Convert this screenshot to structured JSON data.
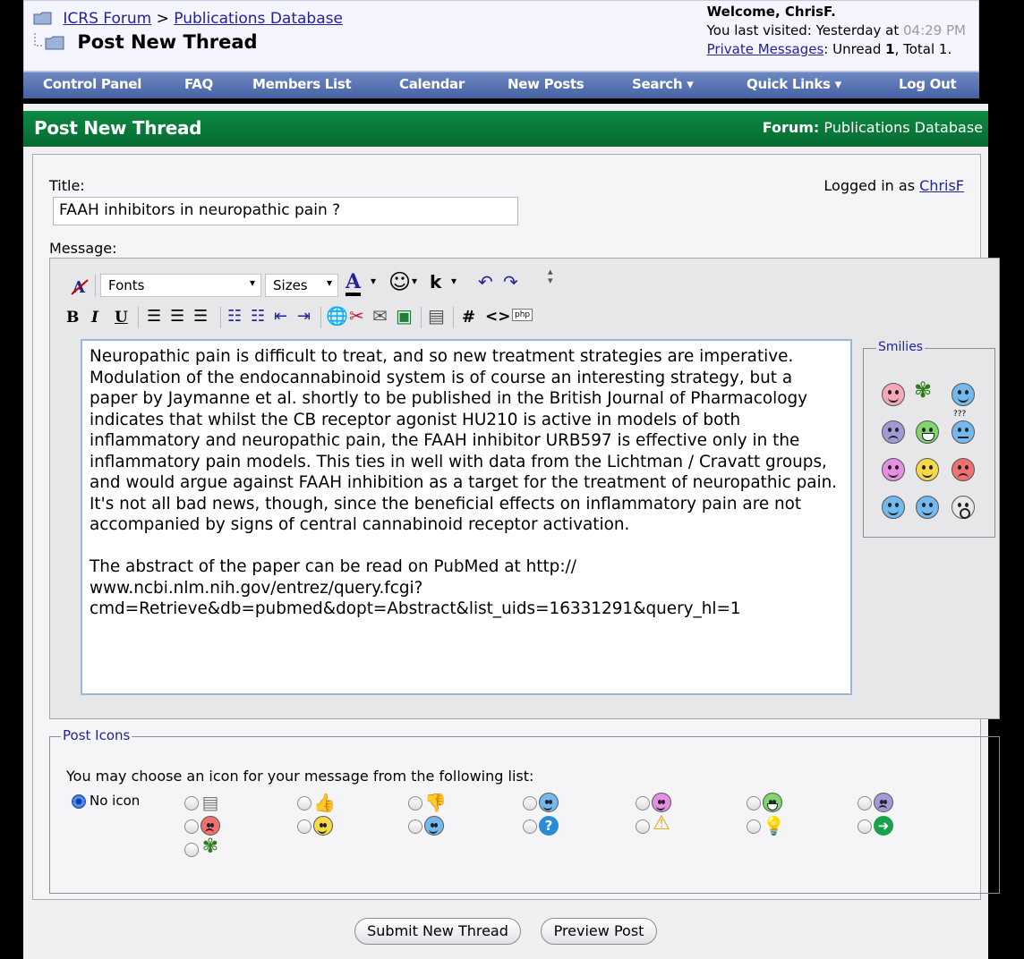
{
  "header": {
    "breadcrumb_forum": "ICRS Forum",
    "breadcrumb_sep": ">",
    "breadcrumb_current": "Publications Database",
    "page_title": "Post New Thread",
    "welcome": "Welcome, ChrisF.",
    "last_visited_label": "You last visited: Yesterday at",
    "last_visited_time": "04:29 PM",
    "pm_link": "Private Messages",
    "pm_unread_label": ": Unread",
    "pm_unread": "1",
    "pm_total": ", Total 1."
  },
  "navbar": {
    "control_panel": "Control Panel",
    "faq": "FAQ",
    "members_list": "Members List",
    "calendar": "Calendar",
    "new_posts": "New Posts",
    "search": "Search ▾",
    "quick_links": "Quick Links ▾",
    "log_out": "Log Out"
  },
  "panel": {
    "title": "Post New Thread",
    "forum_label": "Forum:",
    "forum_name": "Publications Database"
  },
  "form": {
    "title_label": "Title:",
    "title_value": "FAAH inhibitors in neuropathic pain ?",
    "logged_in_label": "Logged in as",
    "logged_in_user": "ChrisF",
    "message_label": "Message:"
  },
  "toolbar": {
    "fonts": "Fonts",
    "sizes": "Sizes",
    "bold": "B",
    "italic": "I",
    "underline": "U",
    "text_color": "A",
    "hash": "#",
    "code": "<>",
    "php": "php"
  },
  "message": {
    "body": "Neuropathic pain is difficult to treat, and so new treatment strategies are imperative. Modulation of the endocannabinoid system is of course an interesting strategy, but a paper by Jaymanne et al. shortly to be published in the British Journal of Pharmacology indicates that whilst the CB receptor agonist HU210 is active in models of both inflammatory and neuropathic pain, the FAAH inhibitor URB597 is effective only in the inflammatory pain models. This ties in well with data from the Lichtman / Cravatt groups, and would argue against FAAH inhibition as a target for the treatment of neuropathic pain. It's not all bad news, though, since the beneficial effects on inflammatory pain are not accompanied by signs of central cannabinoid receptor activation.\n\nThe abstract of the paper can be read on PubMed at http://\nwww.ncbi.nlm.nih.gov/entrez/query.fcgi?\ncmd=Retrieve&db=pubmed&dopt=Abstract&list_uids=16331291&query_hl=1"
  },
  "smilies": {
    "legend": "Smilies",
    "extra_label": "???"
  },
  "post_icons": {
    "legend": "Post Icons",
    "intro": "You may choose an icon for your message from the following list:",
    "no_icon": "No icon"
  },
  "buttons": {
    "submit": "Submit New Thread",
    "preview": "Preview Post"
  },
  "colors": {
    "navbar": "#5572b3",
    "panel_header": "#0a7a3b",
    "link": "#22229c"
  }
}
